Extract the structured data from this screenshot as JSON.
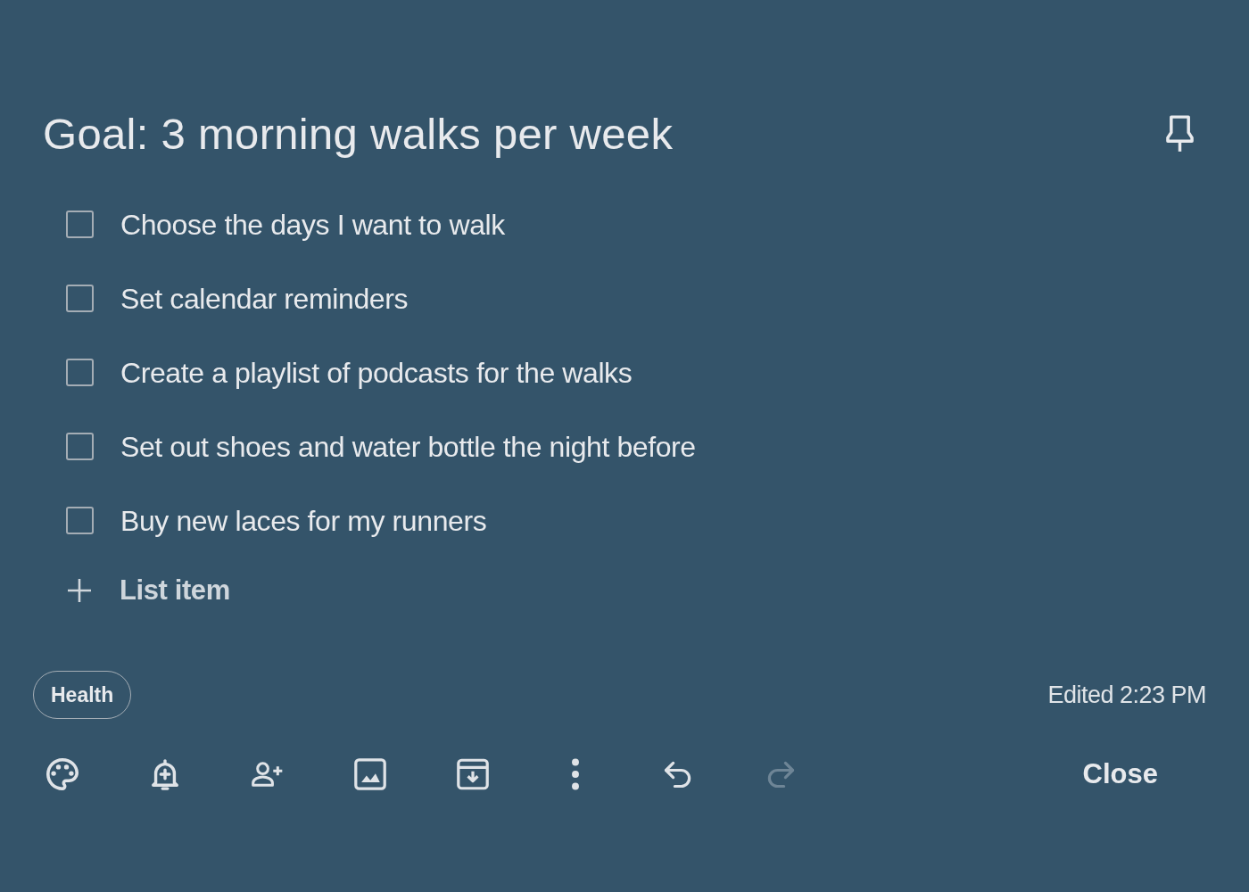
{
  "note": {
    "title": "Goal: 3 morning walks per week"
  },
  "items": [
    {
      "text": "Choose the days I want to walk",
      "checked": false
    },
    {
      "text": "Set calendar reminders",
      "checked": false
    },
    {
      "text": "Create a playlist of podcasts for the walks",
      "checked": false
    },
    {
      "text": "Set out shoes and water bottle the night before",
      "checked": false
    },
    {
      "text": "Buy new laces for my runners",
      "checked": false
    }
  ],
  "add_item": {
    "label": "List item"
  },
  "labels": [
    {
      "text": "Health"
    }
  ],
  "edited": "Edited 2:23 PM",
  "toolbar": [
    {
      "kind": "palette",
      "disabled": false
    },
    {
      "kind": "reminder",
      "disabled": false
    },
    {
      "kind": "collaborator",
      "disabled": false
    },
    {
      "kind": "image",
      "disabled": false
    },
    {
      "kind": "archive",
      "disabled": false
    },
    {
      "kind": "more",
      "disabled": false
    },
    {
      "kind": "undo",
      "disabled": false
    },
    {
      "kind": "redo",
      "disabled": true
    }
  ],
  "close_button": {
    "label": "Close"
  }
}
